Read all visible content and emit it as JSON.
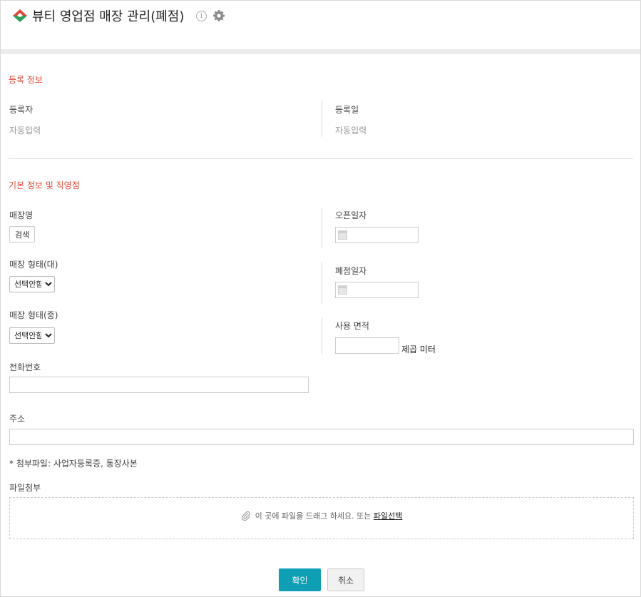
{
  "header": {
    "title": "뷰티 영업점 매장 관리(폐점)",
    "info_icon": "info-icon",
    "settings_icon": "gear-icon",
    "logo_colors": [
      "#e0493a",
      "#2e9f5a"
    ]
  },
  "registration": {
    "section_title": "등록 정보",
    "registrant_label": "등록자",
    "registrant_value": "자동입력",
    "date_label": "등록일",
    "date_value": "자동입력"
  },
  "basic": {
    "section_title": "기본 정보 및 직영점",
    "store_name_label": "매장명",
    "search_button": "검색",
    "open_date_label": "오픈일자",
    "store_type_major_label": "매장 형태(대)",
    "store_type_major_selected": "선택안함",
    "close_date_label": "폐점일자",
    "store_type_mid_label": "매장 형태(중)",
    "store_type_mid_selected": "선택안함",
    "area_label": "사용 면적",
    "area_unit": "제곱 미터",
    "phone_label": "전화번호",
    "address_label": "주소",
    "attachment_note": "* 첨부파일: 사업자등록증, 통장사본",
    "file_label": "파일첨부",
    "dropzone_text": "이 곳에 파일을 드래그 하세요. 또는",
    "dropzone_link": "파일선택"
  },
  "actions": {
    "confirm": "확인",
    "cancel": "취소"
  },
  "colors": {
    "accent": "#0f9fb5",
    "section_title": "#e0493a"
  }
}
